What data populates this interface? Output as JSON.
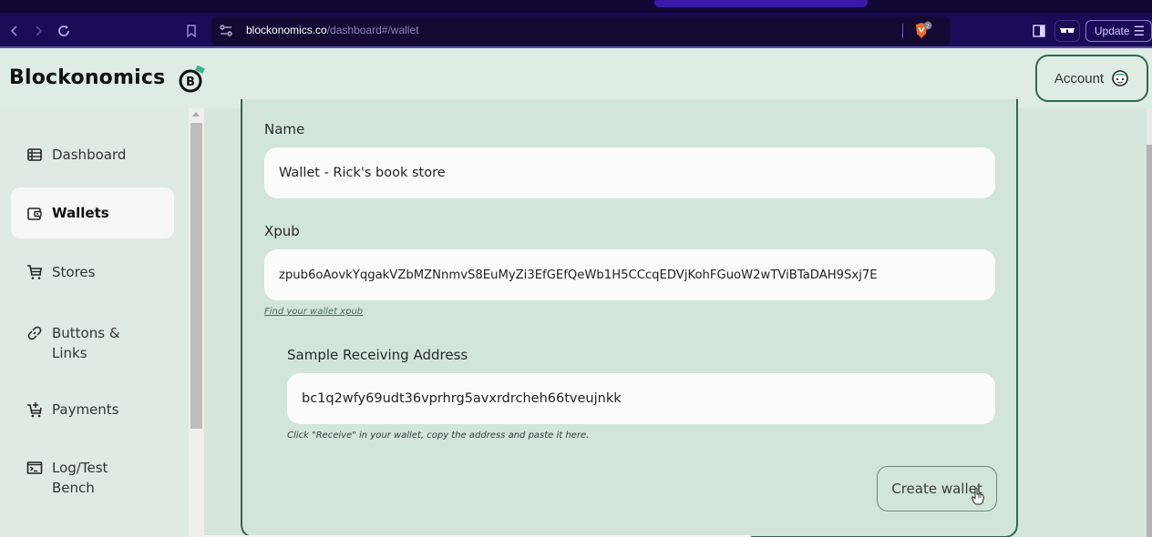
{
  "browser": {
    "url_host": "blockonomics.co",
    "url_path": "/dashboard#/wallet",
    "shields_count": "2",
    "update_label": "Update",
    "icons": {
      "back": "chevron-left-icon",
      "forward": "chevron-right-icon",
      "reload": "reload-icon",
      "bookmark": "bookmark-icon",
      "site_settings": "site-settings-icon",
      "shields": "brave-shields-icon",
      "sidebar": "sidebar-toggle-icon",
      "private": "glasses-icon",
      "menu": "hamburger-menu-icon"
    }
  },
  "header": {
    "logo_text": "Blockonomics",
    "logo_mark_letter": "B",
    "account_label": "Account",
    "colors": {
      "accent": "#2f6a4f",
      "logo_tag": "#3fb28a"
    }
  },
  "sidebar": {
    "items": [
      {
        "label": "Dashboard",
        "icon": "table-icon",
        "active": false
      },
      {
        "label": "Wallets",
        "icon": "wallet-icon",
        "active": true
      },
      {
        "label": "Stores",
        "icon": "cart-icon",
        "active": false
      },
      {
        "label": "Buttons &",
        "label_line2": "Links",
        "icon": "link-icon",
        "active": false
      },
      {
        "label": "Payments",
        "icon": "cart-plus-icon",
        "active": false
      },
      {
        "label": "Log/Test",
        "label_line2": "Bench",
        "icon": "terminal-icon",
        "active": false
      }
    ]
  },
  "form": {
    "name_label": "Name",
    "name_value": "Wallet - Rick's book store",
    "xpub_label": "Xpub",
    "xpub_value": "zpub6oAovkYqgakVZbMZNnmvS8EuMyZi3EfGEfQeWb1H5CCcqEDVjKohFGuoW2wTViBTaDAH9Sxj7E",
    "xpub_help_link": "Find your wallet xpub",
    "address_label": "Sample Receiving Address",
    "address_value": "bc1q2wfy69udt36vprhrg5avxrdrcheh66tveujnkk",
    "address_help": "Click \"Receive\" in your wallet, copy the address and paste it here.",
    "submit_label": "Create wallet"
  }
}
